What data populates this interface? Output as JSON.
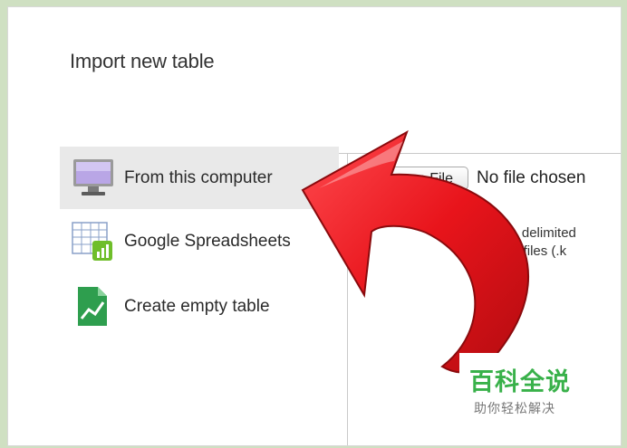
{
  "dialog": {
    "title": "Import new table"
  },
  "sidebar": {
    "items": [
      {
        "label": "From this computer",
        "icon": "monitor-icon",
        "selected": true
      },
      {
        "label": "Google Spreadsheets",
        "icon": "spreadsheet-icon",
        "selected": false
      },
      {
        "label": "Create empty table",
        "icon": "table-file-icon",
        "selected": false
      }
    ]
  },
  "upload": {
    "button_label": "ose File",
    "status": "No file chosen",
    "description_line1": "dsheets, delimited",
    "description_line2": "anguage files (.k"
  },
  "overlay": {
    "arrow_icon": "curved-arrow-icon",
    "arrow_color": "#e8141b"
  },
  "watermark": {
    "title": "百科全说",
    "subtitle": "助你轻松解决",
    "color": "#39b14a"
  }
}
